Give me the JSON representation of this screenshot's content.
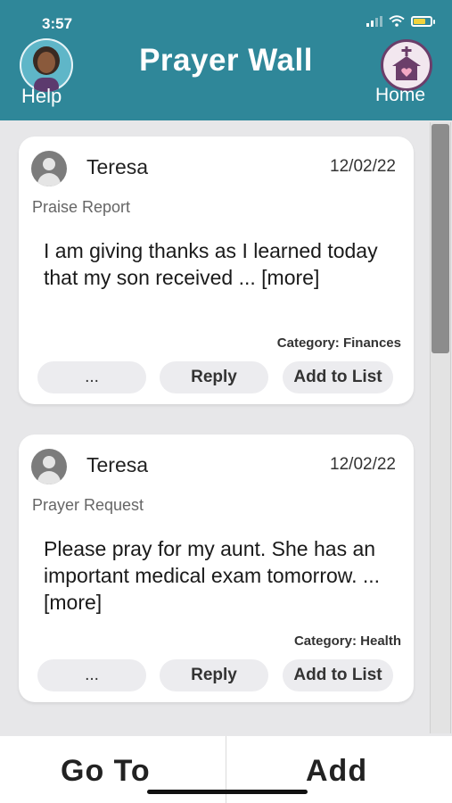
{
  "status": {
    "time": "3:57"
  },
  "header": {
    "title": "Prayer Wall",
    "help_label": "Help",
    "home_label": "Home"
  },
  "posts": [
    {
      "name": "Teresa",
      "date": "12/02/22",
      "type": "Praise Report",
      "message": "I am giving thanks as I learned today that my son received ... [more]",
      "category": "Category: Finances",
      "more_label": "...",
      "reply_label": "Reply",
      "add_label": "Add to List"
    },
    {
      "name": "Teresa",
      "date": "12/02/22",
      "type": "Prayer Request",
      "message": "Please pray for my aunt. She has an important medical exam tomorrow. ... [more]",
      "category": "Category: Health",
      "more_label": "...",
      "reply_label": "Reply",
      "add_label": "Add to List"
    }
  ],
  "bottom": {
    "goto_label": "Go To",
    "add_label": "Add"
  },
  "colors": {
    "header": "#2f8799",
    "background": "#e7e7e9",
    "home_accent": "#6b3e6a"
  },
  "icons": [
    "signal-icon",
    "wifi-icon",
    "battery-icon",
    "help-avatar-icon",
    "church-home-icon",
    "user-icon"
  ]
}
